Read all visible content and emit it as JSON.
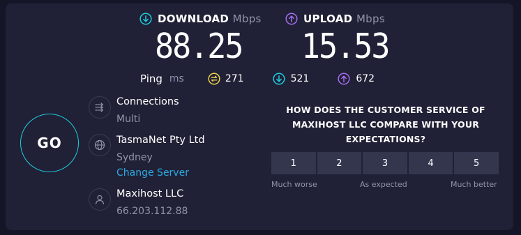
{
  "download": {
    "label": "DOWNLOAD",
    "unit": "Mbps",
    "value": "88.25"
  },
  "upload": {
    "label": "UPLOAD",
    "unit": "Mbps",
    "value": "15.53"
  },
  "ping": {
    "label": "Ping",
    "unit": "ms",
    "idle": "271",
    "download": "521",
    "upload": "672"
  },
  "go_label": "GO",
  "connections": {
    "title": "Connections",
    "value": "Multi"
  },
  "isp": {
    "name": "TasmaNet Pty Ltd",
    "location": "Sydney",
    "change_link": "Change Server"
  },
  "host": {
    "name": "Maxihost LLC",
    "ip": "66.203.112.88"
  },
  "survey": {
    "question": "HOW DOES THE CUSTOMER SERVICE OF MAXIHOST LLC COMPARE WITH YOUR EXPECTATIONS?",
    "options": [
      "1",
      "2",
      "3",
      "4",
      "5"
    ],
    "low_label": "Much worse",
    "mid_label": "As expected",
    "high_label": "Much better"
  },
  "colors": {
    "background": "#141526",
    "panel": "#202136",
    "download_accent": "#1fcde0",
    "upload_accent": "#a56ef0",
    "ping_accent": "#f0d04a",
    "link": "#2da8e0"
  },
  "icons": {
    "download": "download-arrow-circle-icon",
    "upload": "upload-arrow-circle-icon",
    "ping_idle": "jitter-circle-icon",
    "connections": "connections-arrows-icon",
    "isp": "globe-icon",
    "host": "user-icon"
  }
}
